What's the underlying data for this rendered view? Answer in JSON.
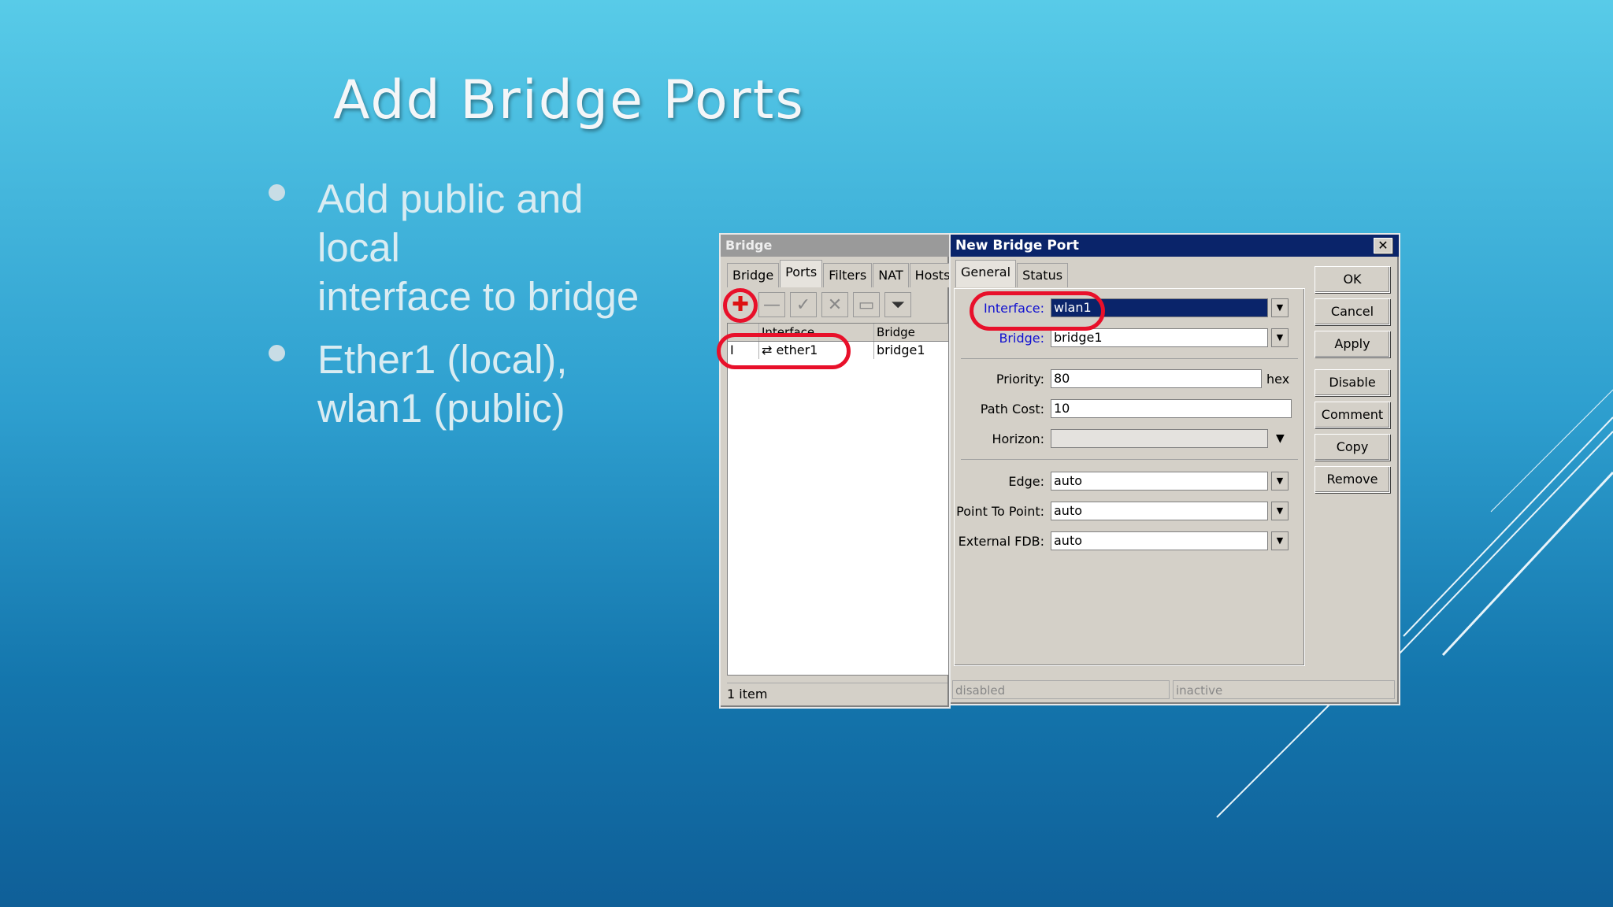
{
  "slide": {
    "title": "Add Bridge Ports",
    "bullets": [
      "Add public and\nlocal\ninterface to bridge",
      "Ether1 (local),\nwlan1 (public)"
    ]
  },
  "bridge_window": {
    "title": "Bridge",
    "tabs": [
      "Bridge",
      "Ports",
      "Filters",
      "NAT",
      "Hosts"
    ],
    "active_tab": "Ports",
    "toolbar_icons": [
      "add-icon",
      "remove-icon",
      "enable-icon",
      "disable-icon",
      "comment-icon",
      "filter-icon"
    ],
    "columns": [
      "",
      "Interface",
      "Bridge"
    ],
    "rows": [
      {
        "flag": "I",
        "interface": "ether1",
        "bridge": "bridge1"
      }
    ],
    "status": "1 item"
  },
  "dialog": {
    "title": "New Bridge Port",
    "tabs": [
      "General",
      "Status"
    ],
    "fields": {
      "interface": {
        "label": "Interface:",
        "value": "wlan1"
      },
      "bridge": {
        "label": "Bridge:",
        "value": "bridge1"
      },
      "priority": {
        "label": "Priority:",
        "value": "80",
        "suffix": "hex"
      },
      "path_cost": {
        "label": "Path Cost:",
        "value": "10"
      },
      "horizon": {
        "label": "Horizon:",
        "value": ""
      },
      "edge": {
        "label": "Edge:",
        "value": "auto"
      },
      "point_to_point": {
        "label": "Point To Point:",
        "value": "auto"
      },
      "external_fdb": {
        "label": "External FDB:",
        "value": "auto"
      }
    },
    "buttons": [
      "OK",
      "Cancel",
      "Apply",
      "Disable",
      "Comment",
      "Copy",
      "Remove"
    ],
    "status": [
      "disabled",
      "inactive"
    ]
  },
  "colors": {
    "highlight_ring": "#e8102a",
    "title_bar": "#0a246a"
  }
}
